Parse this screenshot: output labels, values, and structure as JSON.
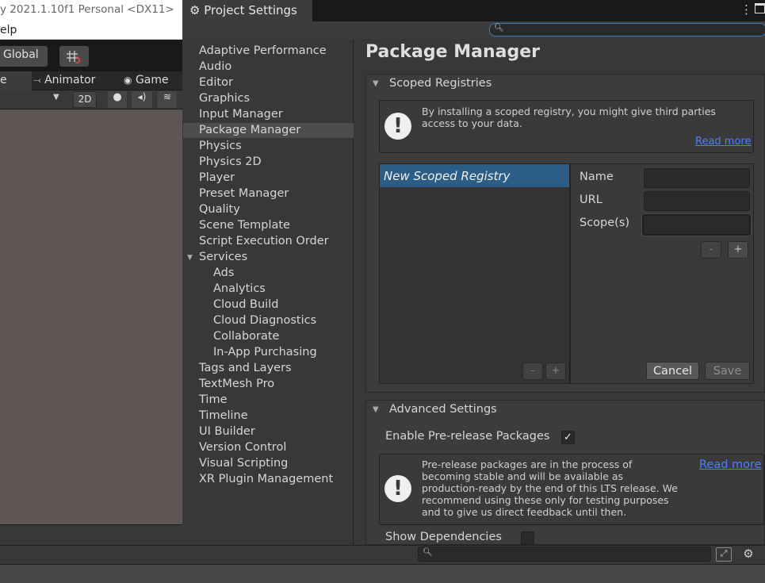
{
  "editor": {
    "title": "y 2021.1.10f1 Personal <DX11>",
    "menu_help": "elp",
    "global_label": "Global",
    "tabs": {
      "scene": "e",
      "animator": "Animator",
      "game": "Game"
    },
    "view_2d_label": "2D"
  },
  "window": {
    "tab_title": "Project Settings",
    "search_placeholder": ""
  },
  "sidebar": {
    "selected": "Package Manager",
    "items": [
      {
        "label": "Adaptive Performance",
        "level": 0
      },
      {
        "label": "Audio",
        "level": 0
      },
      {
        "label": "Editor",
        "level": 0
      },
      {
        "label": "Graphics",
        "level": 0
      },
      {
        "label": "Input Manager",
        "level": 0
      },
      {
        "label": "Package Manager",
        "level": 0
      },
      {
        "label": "Physics",
        "level": 0
      },
      {
        "label": "Physics 2D",
        "level": 0
      },
      {
        "label": "Player",
        "level": 0
      },
      {
        "label": "Preset Manager",
        "level": 0
      },
      {
        "label": "Quality",
        "level": 0
      },
      {
        "label": "Scene Template",
        "level": 0
      },
      {
        "label": "Script Execution Order",
        "level": 0
      },
      {
        "label": "Services",
        "level": 0
      },
      {
        "label": "Ads",
        "level": 1
      },
      {
        "label": "Analytics",
        "level": 1
      },
      {
        "label": "Cloud Build",
        "level": 1
      },
      {
        "label": "Cloud Diagnostics",
        "level": 1
      },
      {
        "label": "Collaborate",
        "level": 1
      },
      {
        "label": "In-App Purchasing",
        "level": 1
      },
      {
        "label": "Tags and Layers",
        "level": 0
      },
      {
        "label": "TextMesh Pro",
        "level": 0
      },
      {
        "label": "Time",
        "level": 0
      },
      {
        "label": "Timeline",
        "level": 0
      },
      {
        "label": "UI Builder",
        "level": 0
      },
      {
        "label": "Version Control",
        "level": 0
      },
      {
        "label": "Visual Scripting",
        "level": 0
      },
      {
        "label": "XR Plugin Management",
        "level": 0
      }
    ]
  },
  "main": {
    "title": "Package Manager",
    "scoped_registries": {
      "title": "Scoped Registries",
      "help_line1": "By installing a scoped registry, you might give third parties",
      "help_line2": "access to your data.",
      "read_more": "Read more",
      "registry_name": "New Scoped Registry",
      "name_label": "Name",
      "url_label": "URL",
      "scopes_label": "Scope(s)",
      "name_value": "",
      "url_value": "",
      "scopes_value": "",
      "remove_label": "-",
      "add_label": "+",
      "cancel_label": "Cancel",
      "save_label": "Save"
    },
    "advanced": {
      "title": "Advanced Settings",
      "prerelease_label": "Enable Pre-release Packages",
      "prerelease_checked": true,
      "help_lines": [
        "Pre-release packages are in the process of",
        "becoming stable and will be available as",
        "production-ready by the end of this LTS release. We",
        "recommend using these only for testing purposes",
        "and to give us direct feedback until then."
      ],
      "read_more": "Read more",
      "show_deps_label": "Show Dependencies",
      "show_deps_checked": false
    }
  },
  "icons": {
    "gear": "gear-icon",
    "warning": "!",
    "check": "✓",
    "foldout": "▼"
  },
  "colors": {
    "selection": "#2c5d87",
    "link": "#4c7eff",
    "search_focus": "#3a79bb"
  }
}
